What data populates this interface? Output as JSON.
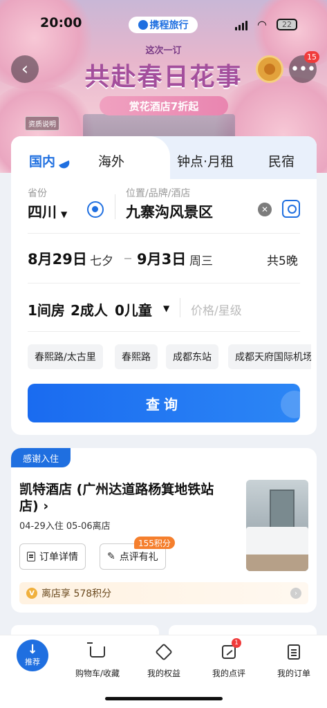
{
  "status_bar": {
    "time": "20:00",
    "brand": "携程旅行",
    "battery": "22"
  },
  "banner": {
    "top_line": "这次一订",
    "title": "共赴春日花事",
    "subtitle": "赏花酒店7折起",
    "qualification": "资质说明",
    "notification_count": "15"
  },
  "search": {
    "tabs": [
      "国内",
      "海外",
      "钟点·月租",
      "民宿"
    ],
    "province_label": "省份",
    "province_value": "四川",
    "location_label": "位置/品牌/酒店",
    "location_value": "九寨沟风景区",
    "checkin_date": "8月29日",
    "checkin_weekday": "七夕",
    "checkout_date": "9月3日",
    "checkout_weekday": "周三",
    "nights": "共5晚",
    "rooms": "1间房",
    "adults": "2成人",
    "children": "0儿童",
    "price_placeholder": "价格/星级",
    "chips": [
      "春熙路/太古里",
      "春熙路",
      "成都东站",
      "成都天府国际机场"
    ],
    "query_button": "查询"
  },
  "order": {
    "tag": "感谢入住",
    "hotel_name": "凯特酒店 (广州达道路杨箕地铁站店)",
    "dates": "04-29入住 05-06离店",
    "detail_button": "订单详情",
    "review_button": "点评有礼",
    "points_badge": "155积分",
    "bonus_text": "离店享 578积分"
  },
  "bottom_nav": {
    "recommend": "推荐",
    "cart": "购物车/收藏",
    "benefits": "我的权益",
    "reviews": "我的点评",
    "reviews_badge": "1",
    "orders": "我的订单"
  },
  "colors": {
    "accent": "#1f6fe0",
    "promo": "#a34e9c",
    "badge_red": "#f03b3b",
    "points_orange": "#f57f2d"
  }
}
